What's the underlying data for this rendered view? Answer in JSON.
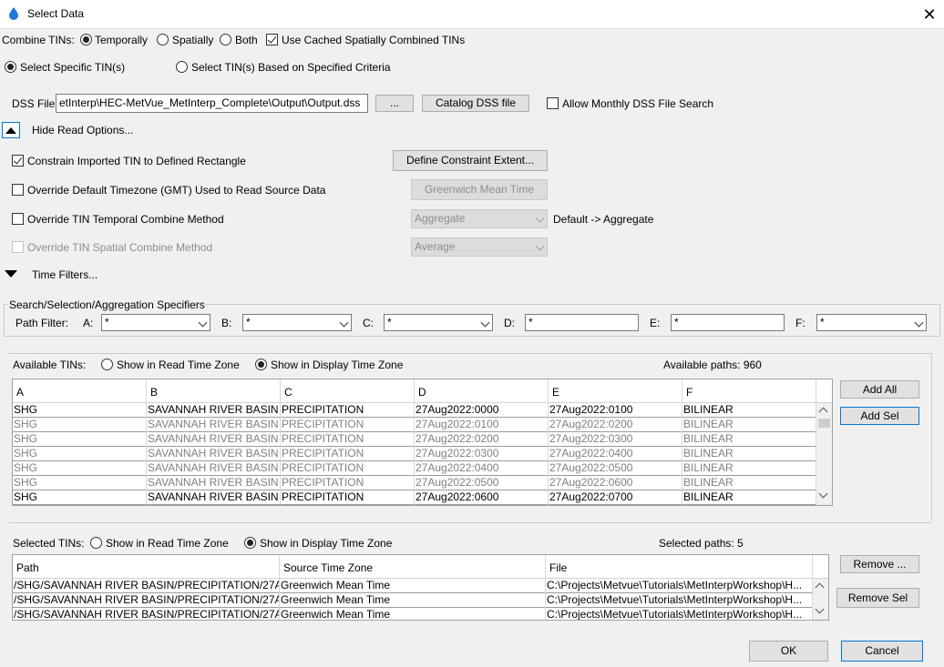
{
  "window": {
    "title": "Select Data",
    "close_glyph": "✕",
    "icon": "water-drop-icon"
  },
  "combine": {
    "label": "Combine TINs:",
    "temporally": "Temporally",
    "spatially": "Spatially",
    "both": "Both",
    "cached": "Use Cached Spatially Combined TINs"
  },
  "selection_mode": {
    "specific": "Select Specific TIN(s)",
    "criteria": "Select TIN(s) Based on Specified Criteria"
  },
  "dss": {
    "label": "DSS File:",
    "value": "etInterp\\HEC-MetVue_MetInterp_Complete\\Output\\Output.dss",
    "browse": "...",
    "catalog": "Catalog DSS file",
    "monthly": "Allow Monthly DSS File Search"
  },
  "read_options": {
    "toggle": "Hide Read Options...",
    "constrain": "Constrain Imported TIN to Defined Rectangle",
    "define_extent": "Define Constraint Extent...",
    "override_tz": "Override Default Timezone (GMT) Used to Read Source Data",
    "tz_button": "Greenwich Mean Time",
    "override_temporal": "Override TIN Temporal Combine Method",
    "temporal_value": "Aggregate",
    "temporal_default": "Default -> Aggregate",
    "override_spatial": "Override TIN Spatial Combine Method",
    "spatial_value": "Average"
  },
  "time_filters": {
    "toggle": "Time Filters..."
  },
  "specifiers": {
    "title": "Search/Selection/Aggregation Specifiers",
    "path_filter": "Path Filter:",
    "a_label": "A:",
    "a_value": "*",
    "b_label": "B:",
    "b_value": "*",
    "c_label": "C:",
    "c_value": "*",
    "d_label": "D:",
    "d_value": "*",
    "e_label": "E:",
    "e_value": "*",
    "f_label": "F:",
    "f_value": "*"
  },
  "available": {
    "label": "Available TINs:",
    "read_tz": "Show in Read Time Zone",
    "display_tz": "Show in Display Time Zone",
    "count": "Available paths: 960",
    "columns": [
      "A",
      "B",
      "C",
      "D",
      "E",
      "F"
    ],
    "rows": [
      [
        "SHG",
        "SAVANNAH RIVER BASIN",
        "PRECIPITATION",
        "27Aug2022:0000",
        "27Aug2022:0100",
        "BILINEAR"
      ],
      [
        "SHG",
        "SAVANNAH RIVER BASIN",
        "PRECIPITATION",
        "27Aug2022:0100",
        "27Aug2022:0200",
        "BILINEAR"
      ],
      [
        "SHG",
        "SAVANNAH RIVER BASIN",
        "PRECIPITATION",
        "27Aug2022:0200",
        "27Aug2022:0300",
        "BILINEAR"
      ],
      [
        "SHG",
        "SAVANNAH RIVER BASIN",
        "PRECIPITATION",
        "27Aug2022:0300",
        "27Aug2022:0400",
        "BILINEAR"
      ],
      [
        "SHG",
        "SAVANNAH RIVER BASIN",
        "PRECIPITATION",
        "27Aug2022:0400",
        "27Aug2022:0500",
        "BILINEAR"
      ],
      [
        "SHG",
        "SAVANNAH RIVER BASIN",
        "PRECIPITATION",
        "27Aug2022:0500",
        "27Aug2022:0600",
        "BILINEAR"
      ],
      [
        "SHG",
        "SAVANNAH RIVER BASIN",
        "PRECIPITATION",
        "27Aug2022:0600",
        "27Aug2022:0700",
        "BILINEAR"
      ]
    ],
    "add_all": "Add All",
    "add_sel": "Add Sel"
  },
  "selected": {
    "label": "Selected TINs:",
    "read_tz": "Show in Read Time Zone",
    "display_tz": "Show in Display Time Zone",
    "count": "Selected paths: 5",
    "columns": [
      "Path",
      "Source Time Zone",
      "File"
    ],
    "rows": [
      [
        "/SHG/SAVANNAH RIVER BASIN/PRECIPITATION/27A...",
        "Greenwich Mean Time",
        "C:\\Projects\\Metvue\\Tutorials\\MetInterpWorkshop\\H..."
      ],
      [
        "/SHG/SAVANNAH RIVER BASIN/PRECIPITATION/27A...",
        "Greenwich Mean Time",
        "C:\\Projects\\Metvue\\Tutorials\\MetInterpWorkshop\\H..."
      ],
      [
        "/SHG/SAVANNAH RIVER BASIN/PRECIPITATION/27A...",
        "Greenwich Mean Time",
        "C:\\Projects\\Metvue\\Tutorials\\MetInterpWorkshop\\H..."
      ]
    ],
    "remove": "Remove ...",
    "remove_sel": "Remove Sel"
  },
  "footer": {
    "ok": "OK",
    "cancel": "Cancel"
  },
  "colors": {
    "accent": "#0078d7",
    "disabled_text": "#8d8d8d",
    "water_drop": "#1e7ad6"
  }
}
